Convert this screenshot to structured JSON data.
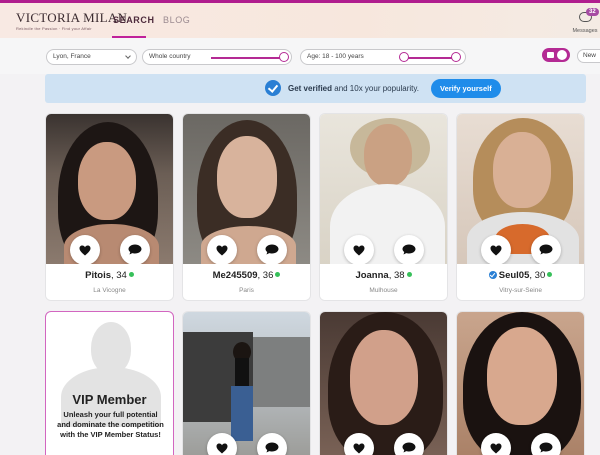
{
  "brand": {
    "name": "VICTORIA MILAN",
    "tagline": "Rekindle the Passion · Find your Affair"
  },
  "nav": {
    "search": "SEARCH",
    "blog": "BLOG"
  },
  "messages": {
    "label": "Messages",
    "count": "32"
  },
  "filters": {
    "location": "Lyon, France",
    "country": "Whole country",
    "age": "Age: 18 - 100 years",
    "sort": "New"
  },
  "banner": {
    "text_bold": "Get verified",
    "text_rest": " and 10x your popularity.",
    "button": "Verify yourself"
  },
  "profiles": [
    {
      "name": "Pitois",
      "age": ", 34",
      "city": "La Vicogne",
      "online": true,
      "verified": false
    },
    {
      "name": "Me245509",
      "age": ", 36",
      "city": "Paris",
      "online": true,
      "verified": false
    },
    {
      "name": "Joanna",
      "age": ", 38",
      "city": "Mulhouse",
      "online": true,
      "verified": false
    },
    {
      "name": "Seul05",
      "age": ", 30",
      "city": "Vitry-sur-Seine",
      "online": true,
      "verified": true
    }
  ],
  "vip": {
    "title": "VIP Member",
    "text": "Unleash your full potential and dominate the competition with the VIP Member Status!"
  },
  "colors": {
    "accent": "#b42a94",
    "verify_blue": "#1f8cea",
    "banner_bg": "#cfe2f3",
    "online": "#37c05a"
  }
}
